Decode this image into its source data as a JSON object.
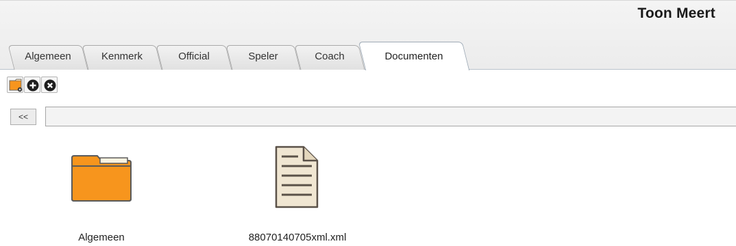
{
  "header": {
    "person_name": "Toon Meert"
  },
  "tabs": [
    {
      "label": "Algemeen",
      "active": false
    },
    {
      "label": "Kenmerk",
      "active": false
    },
    {
      "label": "Official",
      "active": false
    },
    {
      "label": "Speler",
      "active": false
    },
    {
      "label": "Coach",
      "active": false
    },
    {
      "label": "Documenten",
      "active": true
    }
  ],
  "toolbar": {
    "buttons": [
      {
        "icon": "new-folder-icon"
      },
      {
        "icon": "add-circle-icon"
      },
      {
        "icon": "remove-circle-icon"
      }
    ]
  },
  "navigation": {
    "back_label": "<<",
    "path_value": ""
  },
  "items": [
    {
      "type": "folder",
      "name": "Algemeen",
      "icon": "folder-icon"
    },
    {
      "type": "file",
      "name": "88070140705xml.xml",
      "icon": "document-icon"
    }
  ],
  "colors": {
    "folder": "#f7951d",
    "folder_outline": "#5a5a5a",
    "document_fill": "#f0e6d2",
    "document_outline": "#5a5148",
    "active_tab_border": "#9eaab6"
  }
}
